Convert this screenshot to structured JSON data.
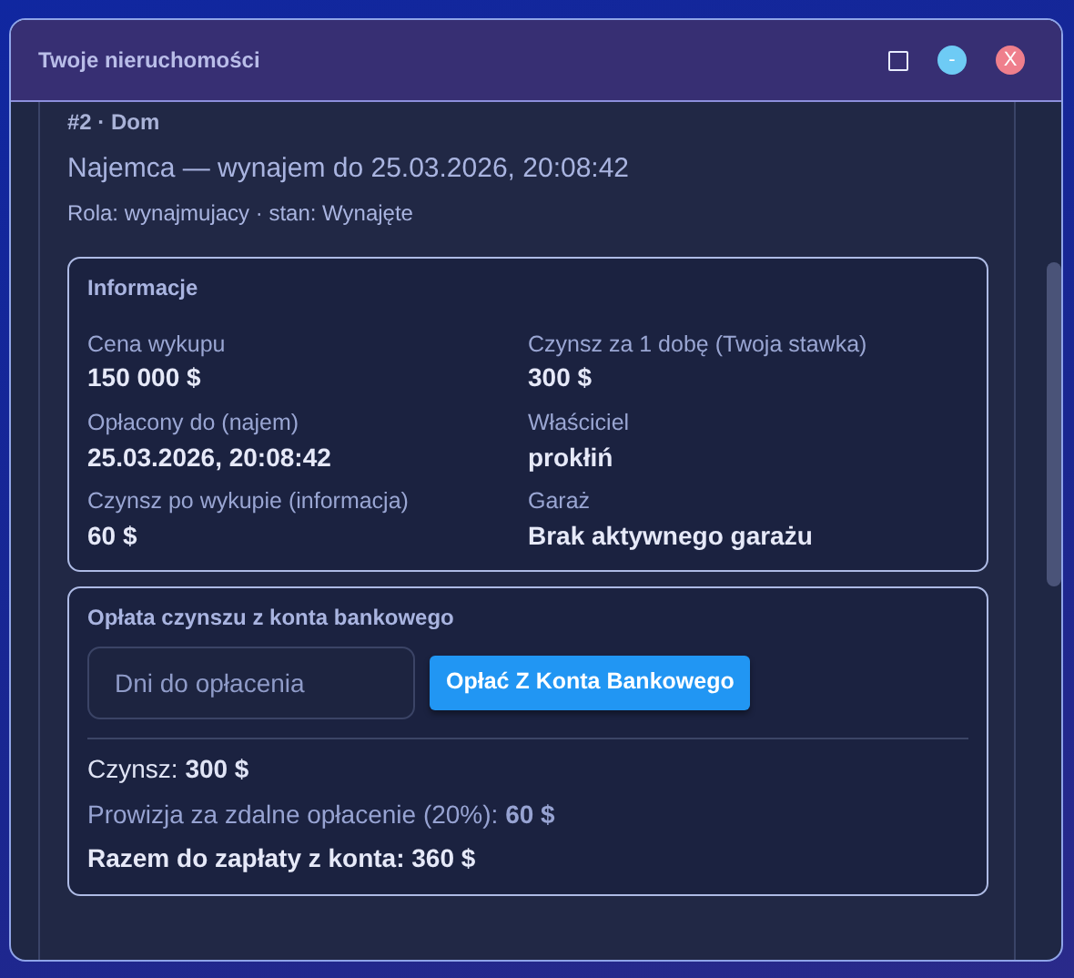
{
  "window": {
    "title": "Twoje nieruchomości",
    "controls": [
      {
        "kind": "maximize"
      },
      {
        "kind": "minimize",
        "label": "-"
      },
      {
        "kind": "close",
        "label": "X"
      }
    ]
  },
  "property": {
    "heading": "#2 · Dom",
    "subtitle": "Najemca — wynajem do 25.03.2026, 20:08:42",
    "role": "Rola: wynajmujacy · stan: Wynajęte"
  },
  "info": {
    "title": "Informacje",
    "fields": [
      {
        "label": "Cena wykupu",
        "value": "150 000 $"
      },
      {
        "label": "Czynsz za 1 dobę (Twoja stawka)",
        "value": "300 $"
      },
      {
        "label": "Opłacony do (najem)",
        "value": "25.03.2026, 20:08:42"
      },
      {
        "label": "Właściciel",
        "value": "prokłiń"
      },
      {
        "label": "Czynsz po wykupie (informacja)",
        "value": "60 $"
      },
      {
        "label": "Garaż",
        "value": "Brak aktywnego garażu"
      }
    ]
  },
  "payment": {
    "title": "Opłata czynszu z konta bankowego",
    "input": {
      "placeholder": "Dni do opłacenia"
    },
    "button": "Opłać Z Konta Bankowego",
    "lines": [
      {
        "kind": "plain",
        "text": "Czynsz: **300 $**"
      },
      {
        "kind": "muted",
        "text": "Prowizja za zdalne opłacenie (20%): **60 $**"
      },
      {
        "kind": "total",
        "text": "Razem do zapłaty z konta: 360 $"
      }
    ]
  }
}
